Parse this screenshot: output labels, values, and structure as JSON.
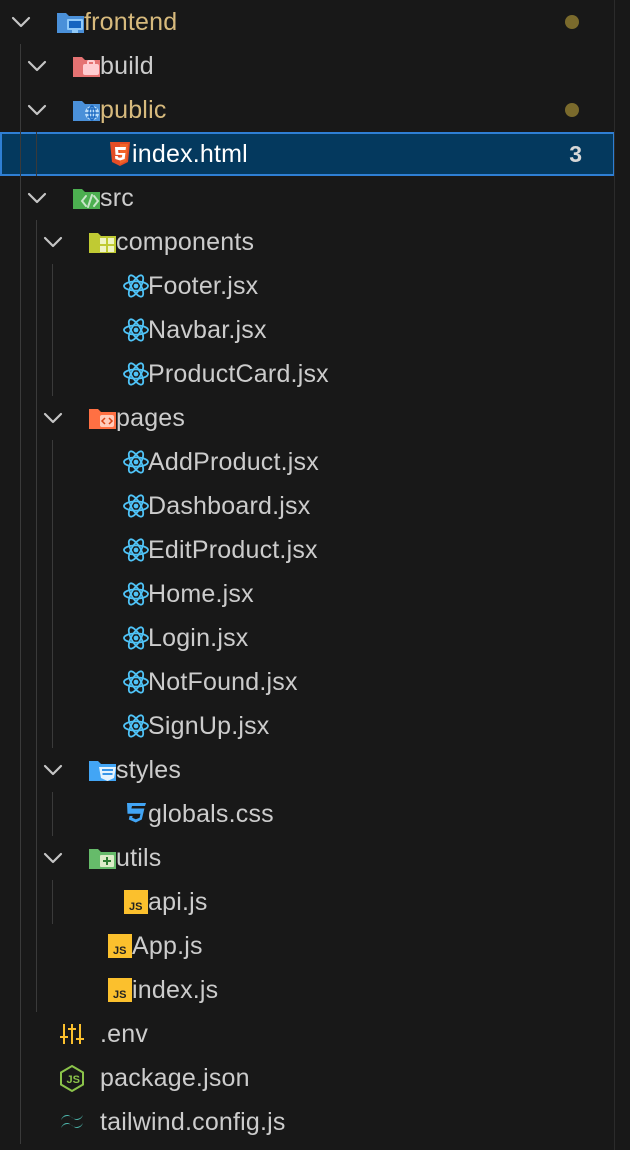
{
  "tree": [
    {
      "id": "frontend",
      "label": "frontend",
      "kind": "folder",
      "icon": "folder-frontend-icon",
      "depth": 0,
      "expanded": true,
      "modified": true
    },
    {
      "id": "build",
      "label": "build",
      "kind": "folder",
      "icon": "folder-build-icon",
      "depth": 1,
      "expanded": true
    },
    {
      "id": "public",
      "label": "public",
      "kind": "folder",
      "icon": "folder-public-icon",
      "depth": 1,
      "expanded": true,
      "modified": true
    },
    {
      "id": "index-html",
      "label": "index.html",
      "kind": "file",
      "icon": "html5-icon",
      "depth": 2,
      "selected": true,
      "problems": "3"
    },
    {
      "id": "src",
      "label": "src",
      "kind": "folder",
      "icon": "folder-src-icon",
      "depth": 1,
      "expanded": true
    },
    {
      "id": "components",
      "label": "components",
      "kind": "folder",
      "icon": "folder-components-icon",
      "depth": 2,
      "expanded": true
    },
    {
      "id": "footer-jsx",
      "label": "Footer.jsx",
      "kind": "file",
      "icon": "react-icon",
      "depth": 3
    },
    {
      "id": "navbar-jsx",
      "label": "Navbar.jsx",
      "kind": "file",
      "icon": "react-icon",
      "depth": 3
    },
    {
      "id": "productcard-jsx",
      "label": "ProductCard.jsx",
      "kind": "file",
      "icon": "react-icon",
      "depth": 3
    },
    {
      "id": "pages",
      "label": "pages",
      "kind": "folder",
      "icon": "folder-pages-icon",
      "depth": 2,
      "expanded": true
    },
    {
      "id": "addproduct-jsx",
      "label": "AddProduct.jsx",
      "kind": "file",
      "icon": "react-icon",
      "depth": 3
    },
    {
      "id": "dashboard-jsx",
      "label": "Dashboard.jsx",
      "kind": "file",
      "icon": "react-icon",
      "depth": 3
    },
    {
      "id": "editproduct-jsx",
      "label": "EditProduct.jsx",
      "kind": "file",
      "icon": "react-icon",
      "depth": 3
    },
    {
      "id": "home-jsx",
      "label": "Home.jsx",
      "kind": "file",
      "icon": "react-icon",
      "depth": 3
    },
    {
      "id": "login-jsx",
      "label": "Login.jsx",
      "kind": "file",
      "icon": "react-icon",
      "depth": 3
    },
    {
      "id": "notfound-jsx",
      "label": "NotFound.jsx",
      "kind": "file",
      "icon": "react-icon",
      "depth": 3
    },
    {
      "id": "signup-jsx",
      "label": "SignUp.jsx",
      "kind": "file",
      "icon": "react-icon",
      "depth": 3
    },
    {
      "id": "styles",
      "label": "styles",
      "kind": "folder",
      "icon": "folder-styles-icon",
      "depth": 2,
      "expanded": true
    },
    {
      "id": "globals-css",
      "label": "globals.css",
      "kind": "file",
      "icon": "css3-icon",
      "depth": 3
    },
    {
      "id": "utils",
      "label": "utils",
      "kind": "folder",
      "icon": "folder-utils-icon",
      "depth": 2,
      "expanded": true
    },
    {
      "id": "api-js",
      "label": "api.js",
      "kind": "file",
      "icon": "javascript-icon",
      "depth": 3
    },
    {
      "id": "app-js",
      "label": "App.js",
      "kind": "file",
      "icon": "javascript-icon",
      "depth": 2
    },
    {
      "id": "index-js",
      "label": "index.js",
      "kind": "file",
      "icon": "javascript-icon",
      "depth": 2
    },
    {
      "id": "env",
      "label": ".env",
      "kind": "file",
      "icon": "env-settings-icon",
      "depth": 1
    },
    {
      "id": "package-json",
      "label": "package.json",
      "kind": "file",
      "icon": "nodejs-icon",
      "depth": 1
    },
    {
      "id": "tailwind-config",
      "label": "tailwind.config.js",
      "kind": "file",
      "icon": "tailwind-icon",
      "depth": 1
    }
  ],
  "colors": {
    "background": "#181818",
    "text": "#cccccc",
    "modified_text": "#d7ba7d",
    "selection_bg": "#04395e",
    "selection_border": "#2f7fd4",
    "modified_dot": "#7a6a2c"
  }
}
